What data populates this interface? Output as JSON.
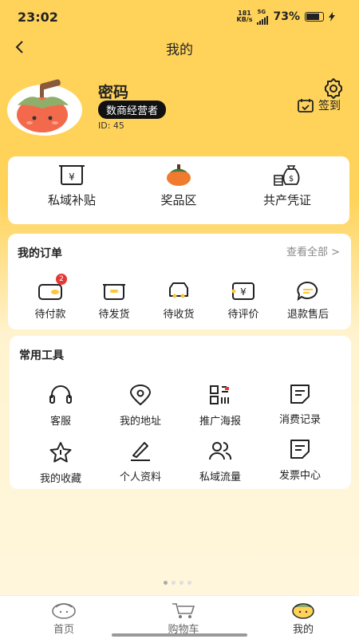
{
  "status_bar": {
    "time": "23:02",
    "network_speed_value": "181",
    "network_speed_unit": "KB/s",
    "network_type": "5G",
    "battery_percent": "73%"
  },
  "header": {
    "title": "我的"
  },
  "profile": {
    "name": "密码",
    "role": "数商经营者",
    "id_text": "ID: 45",
    "checkin_label": "签到"
  },
  "benefits": [
    {
      "label": "私域补贴",
      "icon": "subsidy-box-icon"
    },
    {
      "label": "奖品区",
      "icon": "persimmon-icon"
    },
    {
      "label": "共产凭证",
      "icon": "money-bag-icon"
    }
  ],
  "orders": {
    "title": "我的订单",
    "see_all": "查看全部 >",
    "items": [
      {
        "label": "待付款",
        "badge": "2"
      },
      {
        "label": "待发货"
      },
      {
        "label": "待收货"
      },
      {
        "label": "待评价"
      },
      {
        "label": "退款售后"
      }
    ]
  },
  "tools": {
    "title": "常用工具",
    "items": [
      {
        "label": "客服",
        "icon": "headset-icon"
      },
      {
        "label": "我的地址",
        "icon": "location-icon"
      },
      {
        "label": "推广海报",
        "icon": "qr-poster-icon"
      },
      {
        "label": "消费记录",
        "icon": "record-icon"
      },
      {
        "label": "我的收藏",
        "icon": "star-icon"
      },
      {
        "label": "个人资料",
        "icon": "edit-profile-icon"
      },
      {
        "label": "私域流量",
        "icon": "users-icon"
      },
      {
        "label": "发票中心",
        "icon": "invoice-icon"
      }
    ]
  },
  "tabbar": [
    {
      "label": "首页",
      "active": false
    },
    {
      "label": "购物车",
      "active": false
    },
    {
      "label": "我的",
      "active": true
    }
  ]
}
